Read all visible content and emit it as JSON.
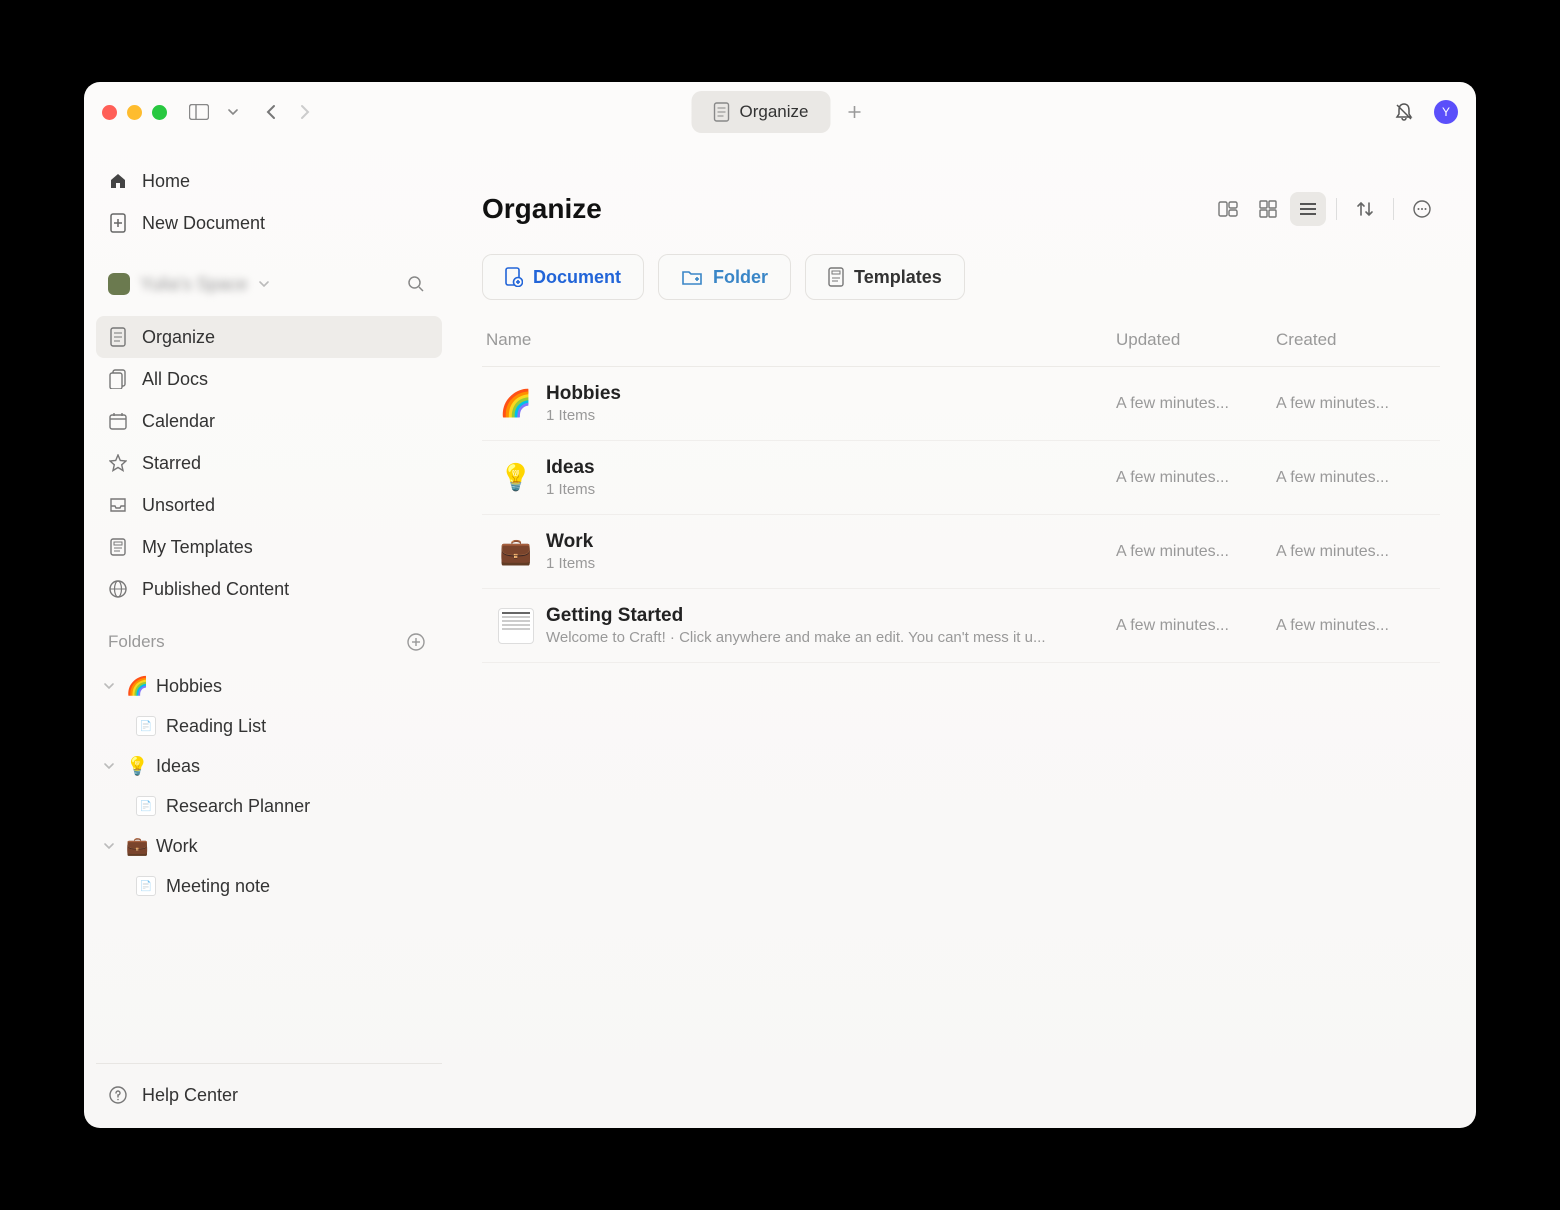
{
  "window": {
    "tab_label": "Organize",
    "avatar_initial": "Y"
  },
  "sidebar": {
    "home": "Home",
    "new_doc": "New Document",
    "workspace_name": "Yulia's Space",
    "nav": [
      {
        "label": "Organize"
      },
      {
        "label": "All Docs"
      },
      {
        "label": "Calendar"
      },
      {
        "label": "Starred"
      },
      {
        "label": "Unsorted"
      },
      {
        "label": "My Templates"
      },
      {
        "label": "Published Content"
      }
    ],
    "folders_header": "Folders",
    "folders": [
      {
        "emoji": "🌈",
        "label": "Hobbies",
        "child": "Reading List"
      },
      {
        "emoji": "💡",
        "label": "Ideas",
        "child": "Research Planner"
      },
      {
        "emoji": "💼",
        "label": "Work",
        "child": "Meeting note"
      }
    ],
    "help": "Help Center"
  },
  "main": {
    "title": "Organize",
    "chips": {
      "document": "Document",
      "folder": "Folder",
      "templates": "Templates"
    },
    "columns": {
      "name": "Name",
      "updated": "Updated",
      "created": "Created"
    },
    "rows": [
      {
        "emoji": "🌈",
        "title": "Hobbies",
        "sub": "1 Items",
        "updated": "A few minutes...",
        "created": "A few minutes..."
      },
      {
        "emoji": "💡",
        "title": "Ideas",
        "sub": "1 Items",
        "updated": "A few minutes...",
        "created": "A few minutes..."
      },
      {
        "emoji": "💼",
        "title": "Work",
        "sub": "1 Items",
        "updated": "A few minutes...",
        "created": "A few minutes..."
      },
      {
        "emoji": "__doc",
        "title": "Getting Started",
        "sub": "Welcome to Craft! · Click anywhere and make an edit. You can't mess it u...",
        "updated": "A few minutes...",
        "created": "A few minutes..."
      }
    ]
  }
}
